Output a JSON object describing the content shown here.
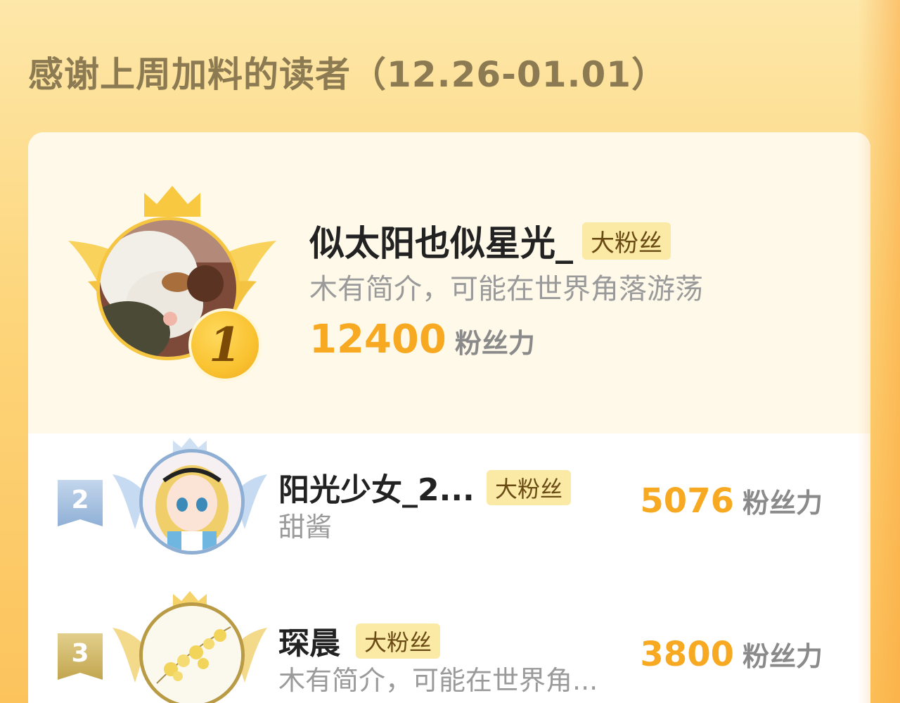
{
  "header": {
    "title": "感谢上周加料的读者（12.26-01.01）"
  },
  "leaderboard": [
    {
      "rank": "1",
      "name": "似太阳也似星光_",
      "badge": "大粉丝",
      "bio": "木有简介，可能在世界角落游荡",
      "score": "12400",
      "score_unit": "粉丝力"
    },
    {
      "rank": "2",
      "name": "阳光少女_2...",
      "badge": "大粉丝",
      "bio": "甜酱",
      "score": "5076",
      "score_unit": "粉丝力"
    },
    {
      "rank": "3",
      "name": "琛晨",
      "badge": "大粉丝",
      "bio": "木有简介，可能在世界角...",
      "score": "3800",
      "score_unit": "粉丝力"
    }
  ],
  "colors": {
    "score": "#f6a921",
    "gold": "#f6c640",
    "silver": "#9fbcdc",
    "bronze": "#cfb669",
    "badge_bg": "#fbeaa6"
  },
  "icons": {
    "rank1_frame": "gold-crown-wings-icon",
    "rank2_frame": "blue-crown-wings-icon",
    "rank3_frame": "gold-crown-wings-icon"
  }
}
